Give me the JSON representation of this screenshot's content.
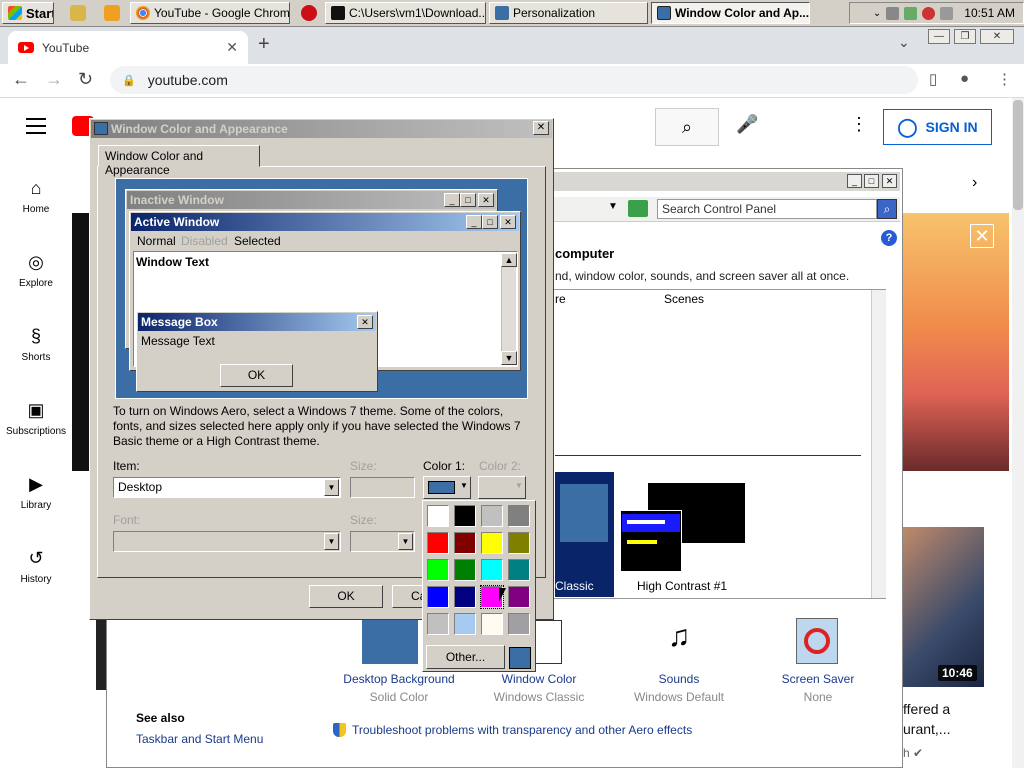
{
  "taskbar": {
    "start_label": "Start",
    "buttons": [
      {
        "label": "YouTube - Google Chrome"
      },
      {
        "label": "C:\\Users\\vm1\\Download..."
      },
      {
        "label": "Personalization"
      },
      {
        "label": "Window Color and Ap..."
      }
    ],
    "clock": "10:51 AM"
  },
  "browser": {
    "tab_title": "YouTube",
    "url": "youtube.com",
    "newtab": "+",
    "tab_close": "✕"
  },
  "youtube": {
    "sign_in": "SIGN IN",
    "sidebar": [
      {
        "label": "Home",
        "icon": "⌂"
      },
      {
        "label": "Explore",
        "icon": "◎"
      },
      {
        "label": "Shorts",
        "icon": "§"
      },
      {
        "label": "Subscriptions",
        "icon": "▣"
      },
      {
        "label": "Library",
        "icon": "▶"
      },
      {
        "label": "History",
        "icon": "↺"
      }
    ],
    "video_duration": "10:46",
    "video_title": "ffered a\nurant,...",
    "video_channel": "h ✔"
  },
  "personalization": {
    "search_placeholder": "Search Control Panel",
    "heading": "computer",
    "description": "nd, window color, sounds, and screen saver all at once.",
    "col_header_1": "re",
    "col_header_2": "Scenes",
    "theme_classic": "Classic",
    "theme_hc": "High Contrast #1",
    "items": [
      {
        "title": "Desktop Background",
        "sub": "Solid Color"
      },
      {
        "title": "Window Color",
        "sub": "Windows Classic"
      },
      {
        "title": "Sounds",
        "sub": "Windows Default"
      },
      {
        "title": "Screen Saver",
        "sub": "None"
      }
    ],
    "see_also": "See also",
    "see_also_link": "Taskbar and Start Menu",
    "troubleshoot": "Troubleshoot problems with transparency and other Aero effects"
  },
  "dialog": {
    "title": "Window Color and Appearance",
    "tab": "Window Color and Appearance",
    "preview": {
      "inactive": "Inactive Window",
      "active": "Active Window",
      "menu_normal": "Normal",
      "menu_disabled": "Disabled",
      "menu_selected": "Selected",
      "window_text": "Window Text",
      "msgbox_title": "Message Box",
      "msgbox_text": "Message Text",
      "msgbox_ok": "OK"
    },
    "aero_text": "To turn on Windows Aero, select a Windows 7 theme.  Some of the colors, fonts, and sizes selected here apply only if you have selected the Windows 7 Basic theme or a High Contrast theme.",
    "item_label": "Item:",
    "item_value": "Desktop",
    "size_label": "Size:",
    "color1_label": "Color 1:",
    "color2_label": "Color 2:",
    "font_label": "Font:",
    "size2_label": "Size:",
    "ok": "OK",
    "cancel": "Ca",
    "current_color": "#3a6ea5"
  },
  "palette": {
    "swatches": [
      "#ffffff",
      "#000000",
      "#c0c0c0",
      "#808080",
      "#ff0000",
      "#800000",
      "#ffff00",
      "#808000",
      "#00ff00",
      "#008000",
      "#00ffff",
      "#008080",
      "#0000ff",
      "#000080",
      "#ff00ff",
      "#800080",
      "#c0c0c0",
      "#a6caf0",
      "#fffbf0",
      "#a0a0a4"
    ],
    "other_label": "Other...",
    "custom_color": "#3a6ea5"
  }
}
